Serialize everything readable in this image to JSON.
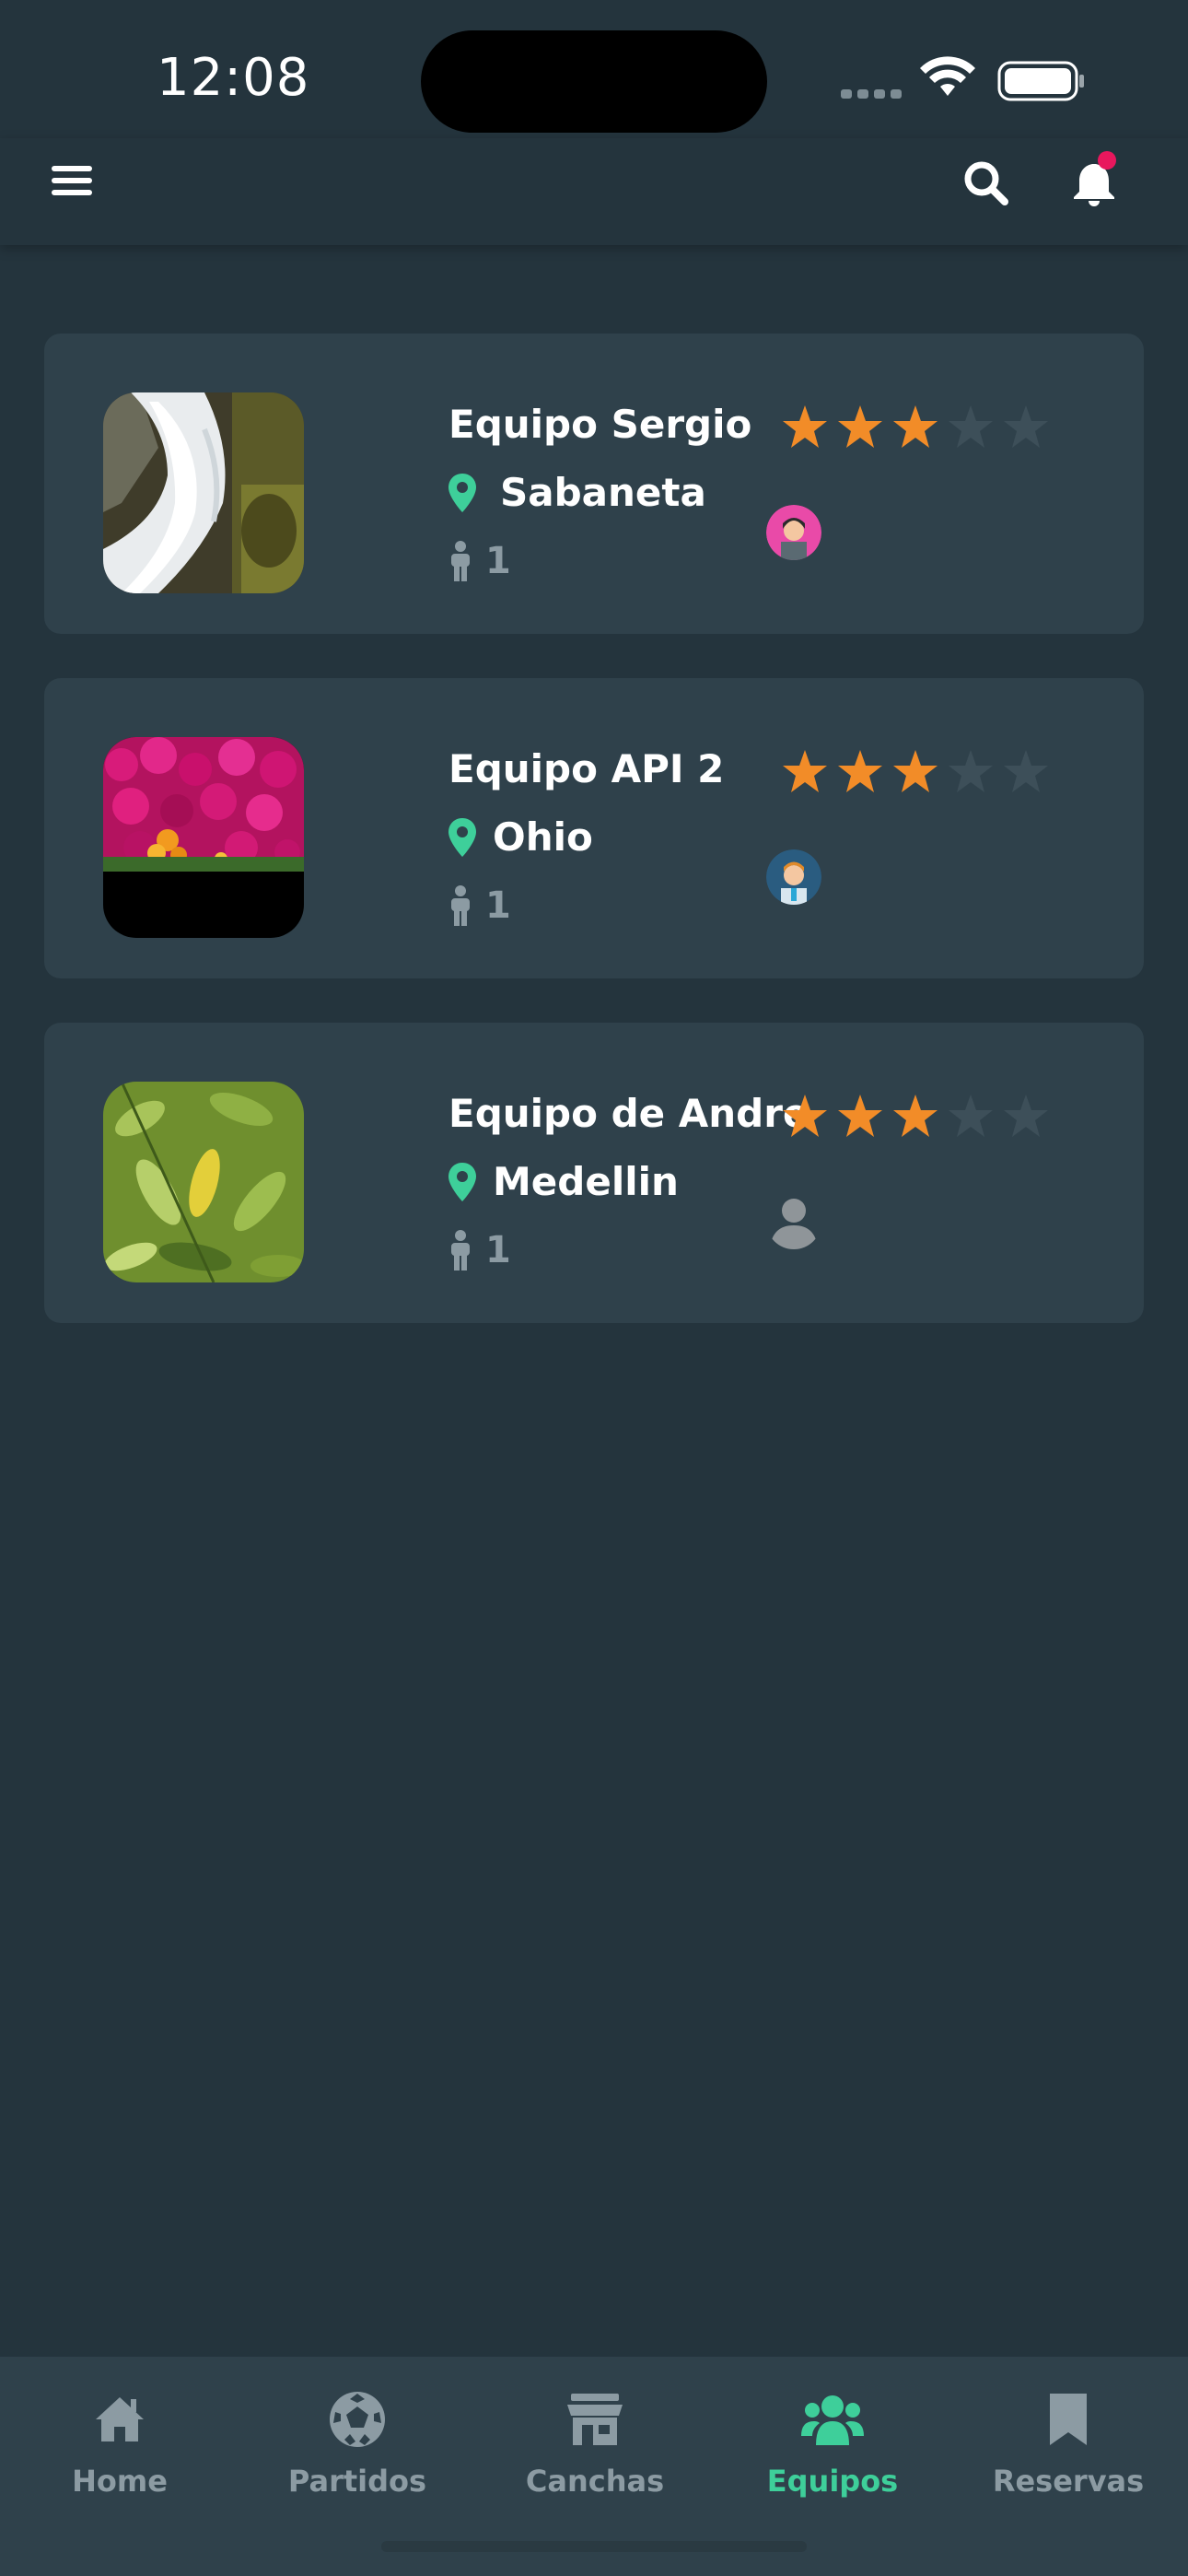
{
  "status_bar": {
    "time": "12:08"
  },
  "header": {
    "menu_icon": "hamburger-menu-icon",
    "search_icon": "search-icon",
    "notification_icon": "bell-icon",
    "notification_dot_color": "#e8175d"
  },
  "teams": [
    {
      "name": "Equipo Sergio",
      "location": "Sabaneta",
      "members": "1",
      "rating": 3,
      "max_rating": 5,
      "photo": "waterfall",
      "member_avatar": "pink-avatar"
    },
    {
      "name": "Equipo API 2",
      "location": "Ohio",
      "members": "1",
      "rating": 3,
      "max_rating": 5,
      "photo": "magenta-flowers",
      "member_avatar": "blue-avatar"
    },
    {
      "name": "Equipo de Andre",
      "location": "Medellin",
      "members": "1",
      "rating": 3,
      "max_rating": 5,
      "photo": "green-leaves",
      "member_avatar": "placeholder-avatar"
    }
  ],
  "nav": {
    "items": [
      {
        "label": "Home",
        "icon": "home-icon"
      },
      {
        "label": "Partidos",
        "icon": "soccer-ball-icon"
      },
      {
        "label": "Canchas",
        "icon": "store-icon"
      },
      {
        "label": "Equipos",
        "icon": "users-icon"
      },
      {
        "label": "Reservas",
        "icon": "bookmark-icon"
      }
    ],
    "active": "Equipos"
  },
  "colors": {
    "background": "#24343d",
    "card": "#2f414b",
    "accent": "#3ecf9a",
    "star_filled": "#f28c28",
    "star_empty": "#3d4f59",
    "muted": "#8c9ba3"
  }
}
